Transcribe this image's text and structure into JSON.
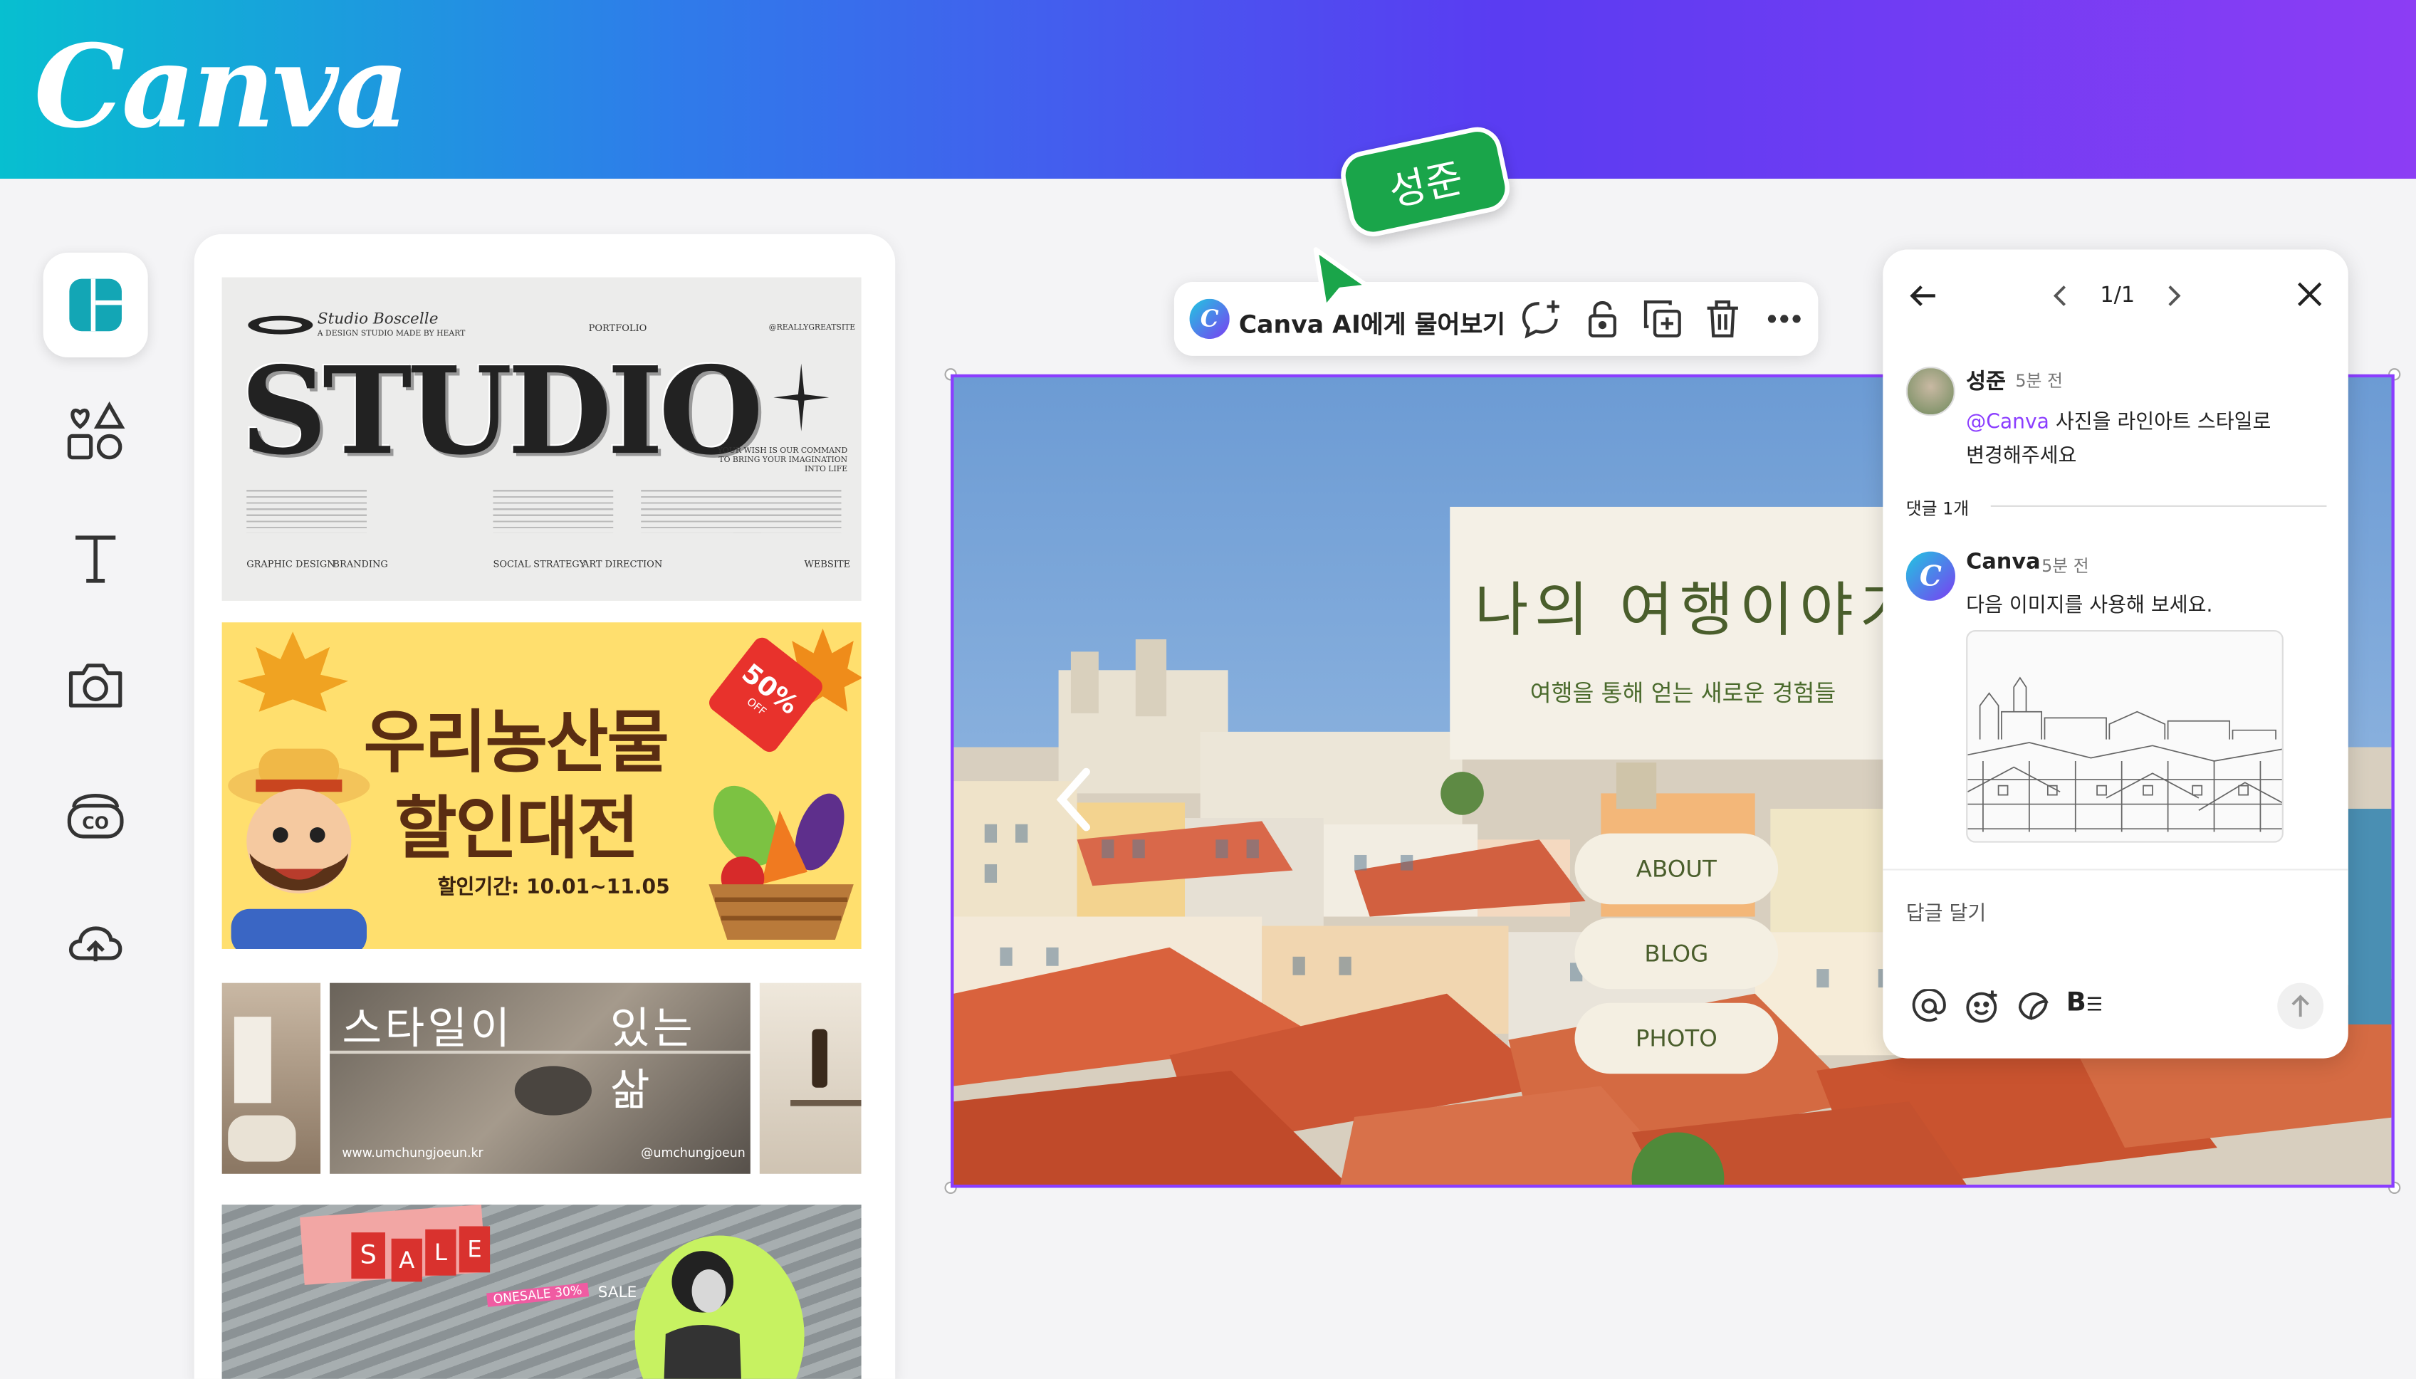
{
  "app": {
    "logo": "Canva",
    "brand_color": "#8b3dff"
  },
  "sidebar": {
    "items": [
      {
        "name": "templates",
        "icon": "templates-icon",
        "active": true
      },
      {
        "name": "elements",
        "icon": "elements-icon"
      },
      {
        "name": "text",
        "icon": "text-icon"
      },
      {
        "name": "photos",
        "icon": "camera-icon"
      },
      {
        "name": "apps",
        "icon": "apps-icon"
      },
      {
        "name": "uploads",
        "icon": "cloud-upload-icon"
      }
    ]
  },
  "templates": {
    "studio": {
      "title": "STUDIO",
      "brand_script": "Studio Boscelle",
      "brand_sub": "A DESIGN STUDIO MADE BY HEART",
      "portfolio": "PORTFOLIO",
      "website": "@REALLYGREATSITE",
      "tagline": "YOUR WISH IS OUR COMMAND TO BRING YOUR IMAGINATION INTO LIFE",
      "footer": [
        "GRAPHIC DESIGN",
        "BRANDING",
        "SOCIAL STRATEGY",
        "ART DIRECTION",
        "WEBSITE"
      ]
    },
    "farm": {
      "line1": "우리농산물",
      "line2": "할인대전",
      "date": "할인기간: 10.01~11.05",
      "tag": "50%",
      "tag_sub": "OFF"
    },
    "style": {
      "left_text": "스타일이",
      "right_text": "있는 삶",
      "url": "www.umchungjoeun.kr",
      "handle": "@umchungjoeun"
    },
    "sale": {
      "letters": [
        "S",
        "A",
        "L",
        "E"
      ],
      "small": "SALE",
      "pink_text": "ONESALE 30%"
    }
  },
  "collaborator": {
    "name": "성준",
    "color": "#1aa54a"
  },
  "toolbar": {
    "ask_ai": "Canva AI에게 물어보기",
    "icons": [
      "add-comment-icon",
      "lock-icon",
      "duplicate-icon",
      "trash-icon",
      "more-icon"
    ]
  },
  "design": {
    "title": "나의 여행이야기",
    "subtitle": "여행을 통해 얻는 새로운 경험들",
    "buttons": [
      "ABOUT",
      "BLOG",
      "PHOTO"
    ]
  },
  "comments": {
    "pager": "1/1",
    "thread": {
      "author": "성준",
      "time": "5분 전",
      "mention": "@Canva",
      "text_1": " 사진을 라인아트 스타일로",
      "text_2": "변경해주세요"
    },
    "reply_count": "댓글 1개",
    "reply": {
      "author": "Canva",
      "time": "5분 전",
      "text": "다음 이미지를 사용해 보세요."
    },
    "input_placeholder": "답글 달기"
  }
}
